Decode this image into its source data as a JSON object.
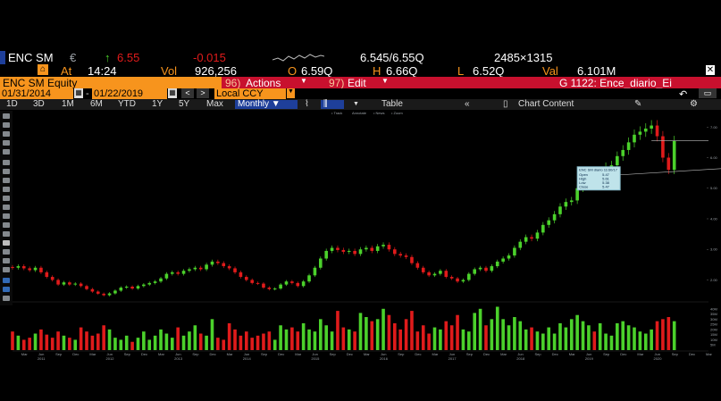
{
  "ticker": {
    "symbol": "ENC SM",
    "currency": "€",
    "last": "6.55",
    "change": "-0.015",
    "bid_ask": "6.545/6.55Q",
    "size": "2485×1315",
    "at_label": "At",
    "time": "14:24",
    "vol_label": "Vol",
    "volume": "926,256",
    "open_label": "O",
    "open": "6.59Q",
    "high_label": "H",
    "high": "6.66Q",
    "low_label": "L",
    "low": "6.52Q",
    "val_label": "Val",
    "value": "6.101M"
  },
  "menu": {
    "security": "ENC SM Equity",
    "actions_num": "96)",
    "actions": "Actions",
    "edit_num": "97)",
    "edit": "Edit",
    "chart_id": "G 1122: Ence_diario_Ei"
  },
  "dates": {
    "start": "01/31/2014",
    "end": "01/22/2019",
    "currency_mode": "Local CCY"
  },
  "toolbar": {
    "ranges": [
      "1D",
      "3D",
      "1M",
      "6M",
      "YTD",
      "1Y",
      "5Y",
      "Max"
    ],
    "frequency": "Monthly",
    "table": "Table",
    "chart_content": "Chart Content"
  },
  "colors": {
    "up": "#4bd12b",
    "down": "#e01b1b",
    "accent_red": "#c8102e",
    "accent_orange": "#f7941d",
    "active_blue": "#1e3f9a"
  },
  "chart_data": {
    "type": "candlestick",
    "frequency": "monthly",
    "price_axis_ticks": [
      "7.00",
      "6.00",
      "5.00",
      "4.00",
      "3.00",
      "2.00"
    ],
    "volume_axis_ticks": [
      "40M",
      "35M",
      "30M",
      "25M",
      "20M",
      "15M",
      "10M",
      "5M"
    ],
    "year_ticks": [
      "2011",
      "2012",
      "2013",
      "2014",
      "2015",
      "2016",
      "2017",
      "2018",
      "2019",
      "2020",
      "2021"
    ],
    "month_ticks": [
      "Mar",
      "Jun",
      "Sep",
      "Dec"
    ],
    "x_range": [
      "2011-01",
      "2021-03"
    ],
    "ylim": [
      1.4,
      7.3
    ],
    "volume_ylim": [
      0,
      45
    ],
    "start": "2011-01",
    "closes": [
      2.4,
      2.45,
      2.38,
      2.32,
      2.4,
      2.25,
      2.1,
      2.0,
      1.85,
      1.92,
      1.85,
      1.88,
      1.8,
      1.7,
      1.62,
      1.55,
      1.5,
      1.56,
      1.65,
      1.75,
      1.78,
      1.72,
      1.8,
      1.85,
      1.9,
      1.95,
      2.05,
      2.2,
      2.25,
      2.2,
      2.3,
      2.35,
      2.4,
      2.35,
      2.5,
      2.6,
      2.55,
      2.45,
      2.38,
      2.25,
      2.1,
      2.0,
      1.9,
      1.88,
      1.75,
      1.7,
      1.72,
      1.85,
      1.95,
      1.9,
      1.8,
      1.95,
      2.15,
      2.4,
      2.7,
      2.95,
      3.05,
      2.98,
      2.92,
      2.95,
      2.85,
      3.0,
      3.05,
      2.95,
      3.1,
      3.15,
      3.0,
      2.85,
      2.8,
      2.75,
      2.55,
      2.4,
      2.25,
      2.15,
      2.2,
      2.3,
      2.1,
      2.05,
      1.95,
      2.0,
      2.2,
      2.35,
      2.4,
      2.3,
      2.45,
      2.6,
      2.7,
      2.8,
      3.05,
      3.25,
      3.4,
      3.35,
      3.55,
      3.8,
      3.95,
      4.15,
      4.4,
      4.55,
      4.6,
      5.0,
      5.2,
      5.35,
      5.25,
      5.5,
      5.7,
      5.75,
      6.05,
      6.25,
      6.5,
      6.75,
      6.85,
      6.95,
      7.05,
      6.7,
      6.0,
      5.6,
      6.55
    ],
    "volumes": [
      18,
      14,
      10,
      12,
      16,
      20,
      15,
      12,
      18,
      14,
      12,
      10,
      22,
      18,
      14,
      16,
      24,
      20,
      12,
      10,
      14,
      8,
      12,
      18,
      10,
      14,
      20,
      16,
      12,
      22,
      14,
      18,
      24,
      16,
      14,
      30,
      12,
      10,
      26,
      20,
      14,
      18,
      12,
      14,
      16,
      18,
      10,
      24,
      20,
      22,
      18,
      26,
      20,
      18,
      30,
      24,
      18,
      38,
      22,
      20,
      18,
      36,
      32,
      28,
      30,
      40,
      34,
      26,
      20,
      30,
      38,
      18,
      24,
      16,
      22,
      20,
      28,
      24,
      34,
      20,
      18,
      36,
      40,
      24,
      30,
      42,
      30,
      24,
      32,
      28,
      20,
      22,
      18,
      16,
      22,
      16,
      26,
      22,
      30,
      34,
      28,
      24,
      18,
      26,
      16,
      14,
      26,
      28,
      24,
      22,
      18,
      16,
      20,
      28,
      30,
      32,
      28
    ]
  },
  "annotation": {
    "title": "ENC SM diario 11/30/17",
    "rows": [
      [
        "Open",
        "5.47"
      ],
      [
        "High",
        "5.61"
      ],
      [
        "Low",
        "5.38"
      ],
      [
        "Close",
        "5.47"
      ]
    ]
  }
}
